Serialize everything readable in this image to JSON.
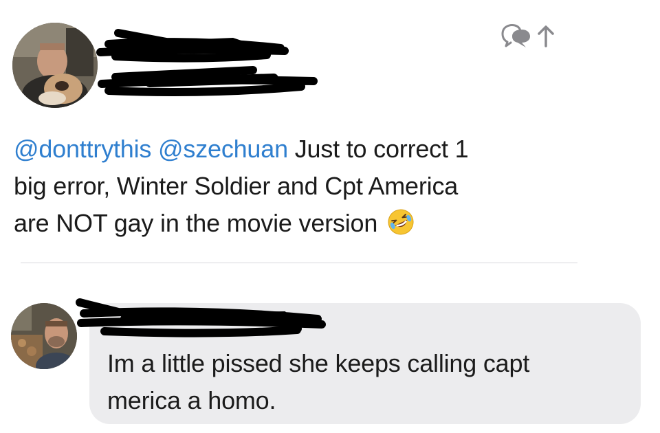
{
  "tweet": {
    "mentions": [
      "@donttrythis",
      "@szechuan"
    ],
    "text_line1": " Just to correct 1",
    "text_line2": "big error, Winter Soldier and Cpt America",
    "text_line3": "are NOT gay in the movie version",
    "emoji": "rolling-on-the-floor-laughing",
    "author_redacted": true
  },
  "header_icons": [
    "reply-conversation-icon",
    "share-arrow-icon"
  ],
  "reply": {
    "text_line1": "Im a little pissed she keeps calling capt",
    "text_line2": "merica a homo.",
    "author_redacted": true
  },
  "colors": {
    "mention": "#2f7fcf",
    "text": "#1b1b1b",
    "bubble": "#ececee",
    "divider": "#d8d8dc",
    "icon": "#8a8a8e"
  }
}
